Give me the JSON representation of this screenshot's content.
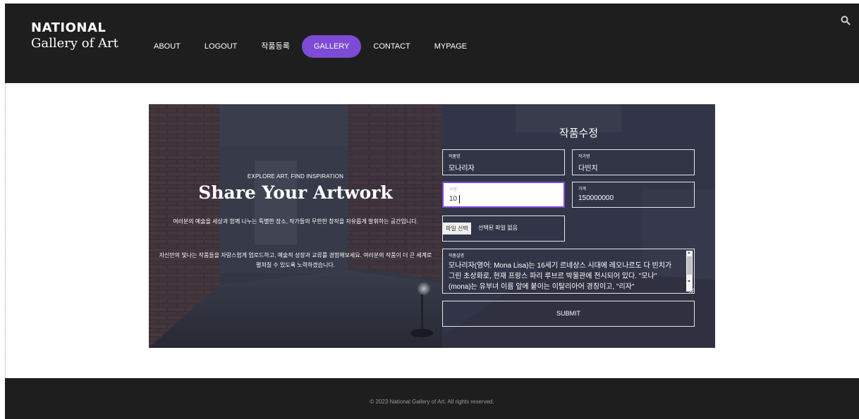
{
  "header": {
    "logo_line1": "NATIONAL",
    "logo_line2": "Gallery of Art",
    "nav": [
      {
        "label": "ABOUT",
        "active": false
      },
      {
        "label": "LOGOUT",
        "active": false
      },
      {
        "label": "작품등록",
        "active": false
      },
      {
        "label": "GALLERY",
        "active": true
      },
      {
        "label": "CONTACT",
        "active": false
      },
      {
        "label": "MYPAGE",
        "active": false
      }
    ],
    "search_icon": "search-icon"
  },
  "hero": {
    "eyebrow": "EXPLORE ART, FIND INSPIRATION",
    "headline": "Share Your Artwork",
    "paragraph1": "여러분의 예술을 세상과 함께 나누는 특별한 장소, 작가들의 무한한 창작을 자유롭게 발휘하는 공간입니다.",
    "paragraph2": "자신만의 빛나는 작품들을 자랑스럽게 업로드하고, 예술적 성장과 교류를 경험해보세요. 여러분의 작품이 더 큰 세계로 펼쳐질 수 있도록 노력하겠습니다."
  },
  "form": {
    "title": "작품수정",
    "artwork_name": {
      "label": "작품명",
      "value": "모나리자"
    },
    "artist_name": {
      "label": "작가명",
      "value": "다빈치"
    },
    "quantity": {
      "label": "수량",
      "value": "10"
    },
    "price": {
      "label": "가격",
      "value": "150000000"
    },
    "file": {
      "button": "파일 선택",
      "status": "선택된 파일 없음"
    },
    "description": {
      "label": "작품설명",
      "value": "모나리자(영어: Mona Lisa)는 16세기 르네상스 시대에 레오나르도 다 빈치가 그린 초상화로, 현재 프랑스 파리 루브르 박물관에 전시되어 있다. \"모나\"(mona)는 유부녀 이름 앞에 붙이는 이탈리아어 경칭이고, \"리자\""
    },
    "submit_label": "SUBMIT"
  },
  "footer": {
    "copyright": "© 2023 National Gallery of Art. All rights reserved."
  },
  "colors": {
    "accent": "#7d4bd6",
    "header_bg": "#1e1e1e",
    "footer_bg": "#1e1e1e",
    "hero_overlay": "#2e3140"
  }
}
